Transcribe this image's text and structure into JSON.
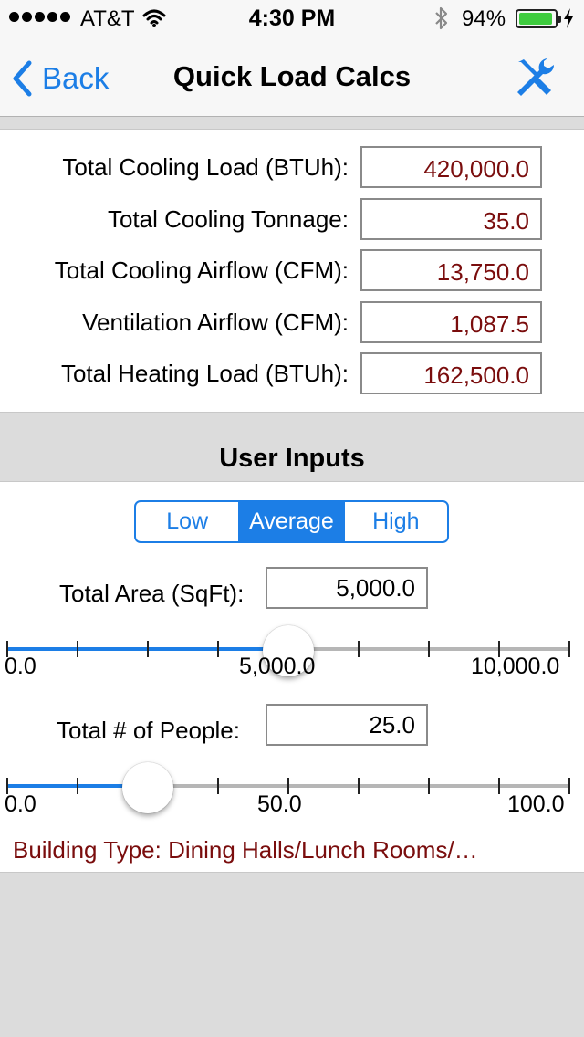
{
  "status_bar": {
    "carrier": "AT&T",
    "time": "4:30 PM",
    "battery_percent": "94%",
    "battery_level": 0.94,
    "icons": [
      "signal-dots-icon",
      "wifi-icon",
      "bluetooth-icon",
      "battery-icon",
      "charging-bolt-icon"
    ]
  },
  "nav": {
    "back_label": "Back",
    "title": "Quick Load Calcs",
    "tools_icon": "tools-icon"
  },
  "results": [
    {
      "label": "Total Cooling Load (BTUh):",
      "value": "420,000.0"
    },
    {
      "label": "Total Cooling Tonnage:",
      "value": "35.0"
    },
    {
      "label": "Total Cooling Airflow (CFM):",
      "value": "13,750.0"
    },
    {
      "label": "Ventilation Airflow (CFM):",
      "value": "1,087.5"
    },
    {
      "label": "Total Heating Load (BTUh):",
      "value": "162,500.0"
    }
  ],
  "inputs_header": "User Inputs",
  "segmented": {
    "options": [
      "Low",
      "Average",
      "High"
    ],
    "selected": "Average"
  },
  "area": {
    "label": "Total Area (SqFt):",
    "value": "5,000.0",
    "slider": {
      "min_label": "0.0",
      "mid_label": "5,000.0",
      "max_label": "10,000.0",
      "min": 0,
      "max": 10000,
      "value": 5000,
      "ticks": 9
    }
  },
  "people": {
    "label": "Total # of People:",
    "value": "25.0",
    "slider": {
      "min_label": "0.0",
      "mid_label": "50.0",
      "max_label": "100.0",
      "min": 0,
      "max": 100,
      "value": 25,
      "ticks": 9
    }
  },
  "building_type": "Building Type: Dining Halls/Lunch Rooms/…",
  "colors": {
    "accent": "#1c7ee6",
    "result_text": "#7a0d0d",
    "background": "#dcdcdc",
    "battery_green": "#3fcc3f"
  }
}
